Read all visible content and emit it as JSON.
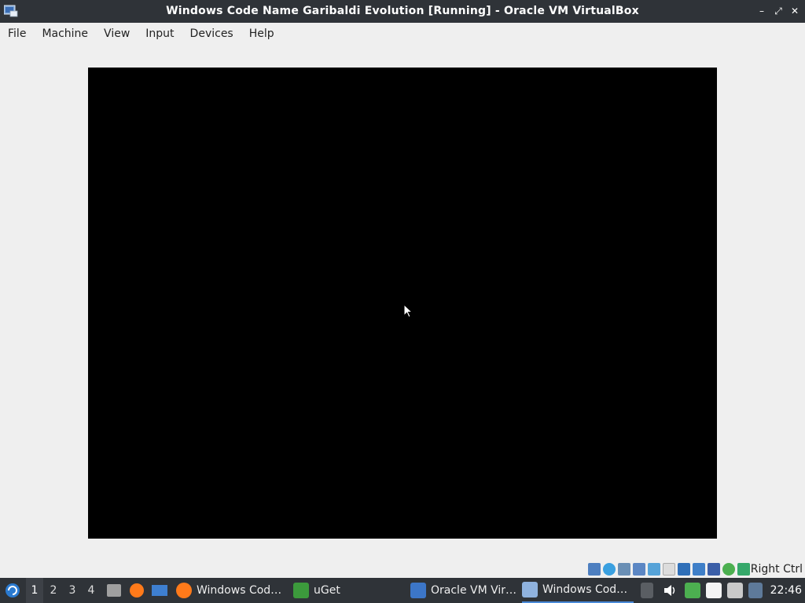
{
  "window": {
    "title": "Windows Code Name Garibaldi Evolution [Running] - Oracle VM VirtualBox",
    "controls": {
      "minimize": "–",
      "maximize": "⤢",
      "close": "✕"
    }
  },
  "menu": {
    "items": [
      "File",
      "Machine",
      "View",
      "Input",
      "Devices",
      "Help"
    ]
  },
  "statusbar": {
    "host_key": "Right Ctrl",
    "icons": [
      "hard-disk-icon",
      "optical-drive-icon",
      "audio-icon",
      "network-icon",
      "usb-icon",
      "shared-folders-icon",
      "display-icon",
      "video-capture-icon",
      "virtualization-icon",
      "mouse-integration-icon",
      "keyboard-icon"
    ]
  },
  "taskbar": {
    "workspaces": [
      "1",
      "2",
      "3",
      "4"
    ],
    "active_workspace": "1",
    "tasks": [
      {
        "label": "Windows Cod…",
        "icon": "firefox-icon"
      },
      {
        "label": "uGet",
        "icon": "uget-icon"
      },
      {
        "label": "Oracle VM Vir…",
        "icon": "virtualbox-icon"
      },
      {
        "label": "Windows Cod…",
        "icon": "vm-vista-icon",
        "active": true
      }
    ],
    "clock": "22:46"
  },
  "colors": {
    "titlebar_bg": "#2f3338",
    "vm_screen": "#000000",
    "chrome_bg": "#efefef",
    "accent": "#4a8ad8"
  }
}
